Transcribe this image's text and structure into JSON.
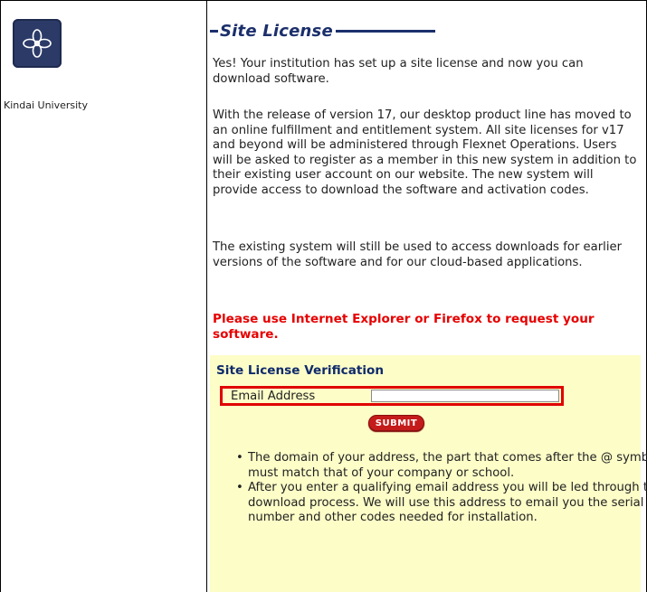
{
  "sidebar": {
    "institution": "Kindai University",
    "logo_icon": "flower-icon"
  },
  "main": {
    "title": "Site License",
    "para1": "Yes! Your institution has set up a site license and now you can download software.",
    "para2": "With the release of version 17, our desktop product line has moved to an online fulfillment and entitlement system. All site licenses for v17 and beyond will be administered through Flexnet Operations. Users will be asked to register as a member in this new system in addition to their existing user account on our website. The new system will provide access to download the software and activation codes.",
    "para3": "The existing system will still be used to access downloads for earlier versions of the software and for our cloud-based applications.",
    "warning": "Please use Internet Explorer or Firefox to request your software."
  },
  "verification": {
    "title": "Site License Verification",
    "email_label": "Email Address",
    "email_value": "",
    "submit_label": "SUBMIT",
    "bullets": [
      "The domain of your address, the part that comes after the @ symbol, must match that of your company or school.",
      "After you enter a qualifying email address you will be led through the download process. We will use this address to email you the serial number and other codes needed for installation."
    ]
  },
  "colors": {
    "title": "#1b2f6b",
    "warning": "#e60000",
    "verify_bg": "#fdfdc8",
    "submit_bg": "#c41b1b"
  }
}
